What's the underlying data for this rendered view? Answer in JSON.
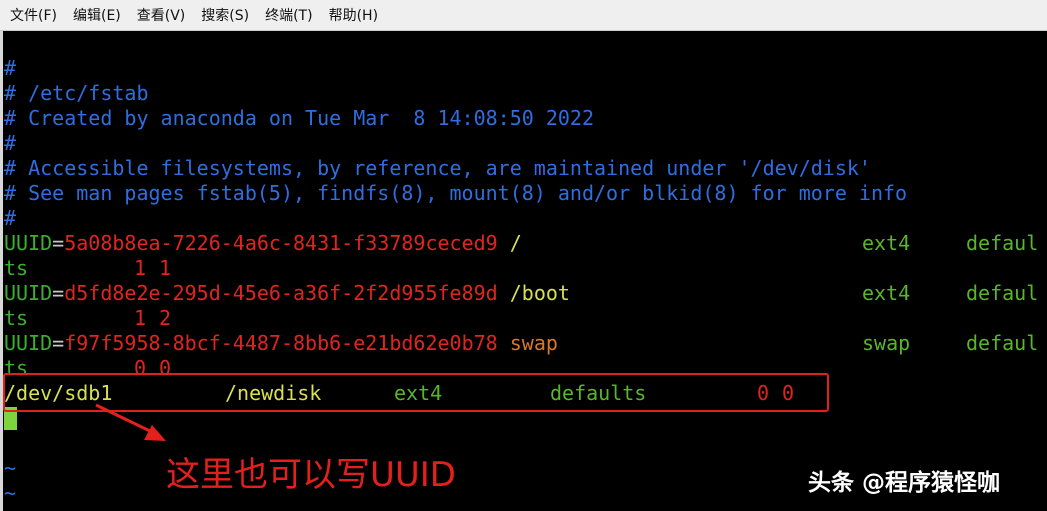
{
  "menubar": {
    "items": [
      "文件(F)",
      "编辑(E)",
      "查看(V)",
      "搜索(S)",
      "终端(T)",
      "帮助(H)"
    ]
  },
  "terminal": {
    "comments": [
      "#",
      "# /etc/fstab",
      "# Created by anaconda on Tue Mar  8 14:08:50 2022",
      "#",
      "# Accessible filesystems, by reference, are maintained under '/dev/disk'",
      "# See man pages fstab(5), findfs(8), mount(8) and/or blkid(8) for more info",
      "#"
    ],
    "entries": [
      {
        "key": "UUID",
        "eq": "=",
        "uuid": "5a08b8ea-7226-4a6c-8431-f33789ceced9",
        "mount": "/",
        "type": "ext4",
        "opts_a": "defaul",
        "opts_b": "ts",
        "dump": "1",
        "pass": "1"
      },
      {
        "key": "UUID",
        "eq": "=",
        "uuid": "d5fd8e2e-295d-45e6-a36f-2f2d955fe89d",
        "mount": "/boot",
        "type": "ext4",
        "opts_a": "defaul",
        "opts_b": "ts",
        "dump": "1",
        "pass": "2"
      },
      {
        "key": "UUID",
        "eq": "=",
        "uuid": "f97f5958-8bcf-4487-8bb6-e21bd62e0b78",
        "mount": "swap",
        "type": "swap",
        "opts_a": "defaul",
        "opts_b": "ts",
        "dump": "0",
        "pass": "0"
      }
    ],
    "new_entry": {
      "device": "/dev/sdb1",
      "mount": "/newdisk",
      "type": "ext4",
      "opts": "defaults",
      "dump": "0",
      "pass": "0"
    },
    "tildes": [
      "~",
      "~"
    ]
  },
  "annotation": "这里也可以写UUID",
  "watermark": "头条 @程序猿怪咖",
  "colors": {
    "comment": "#2f6de0",
    "uuid": "#e0251f",
    "key": "#3ab02d",
    "mount": "#d8e052",
    "highlight": "#e02020"
  }
}
